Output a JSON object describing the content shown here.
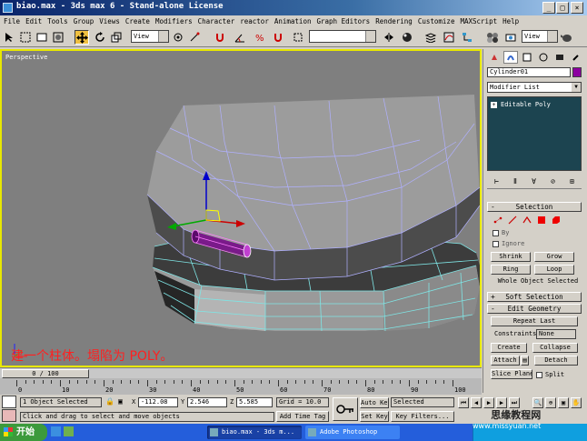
{
  "window": {
    "title": "biao.max - 3ds max 6 - Stand-alone License",
    "controls": [
      "minimize-icon",
      "maximize-icon",
      "close-icon"
    ]
  },
  "menu": [
    "File",
    "Edit",
    "Tools",
    "Group",
    "Views",
    "Create",
    "Modifiers",
    "Character",
    "reactor",
    "Animation",
    "Graph Editors",
    "Rendering",
    "Customize",
    "MAXScript",
    "Help"
  ],
  "toolbar": {
    "ref_coord": "View",
    "named_selection": "",
    "render_view": "View"
  },
  "viewport": {
    "label": "Perspective",
    "caption": "建一个柱体。塌陷为 POLY。"
  },
  "command_panel": {
    "object_name": "Cylinder01",
    "object_color": "#8c00a0",
    "modifier_list": "Modifier List",
    "stack_item": "Editable Poly",
    "selection": {
      "title": "Selection",
      "by": "By",
      "ignore": "Ignore",
      "shrink": "Shrink",
      "grow": "Grow",
      "ring": "Ring",
      "loop": "Loop",
      "status": "Whole Object Selected"
    },
    "soft_selection": "Soft Selection",
    "edit_geometry": {
      "title": "Edit Geometry",
      "repeat_last": "Repeat Last",
      "constraints_label": "Constraints:",
      "constraints_value": "None",
      "create": "Create",
      "collapse": "Collapse",
      "attach": "Attach",
      "detach": "Detach",
      "slice_plane": "Slice Plane",
      "split": "Split"
    }
  },
  "timeline": {
    "frame": "0 / 100",
    "ticks": [
      "0",
      "10",
      "20",
      "30",
      "40",
      "50",
      "60",
      "70",
      "80",
      "90",
      "100"
    ]
  },
  "status": {
    "selection": "1 Object Selected",
    "prompt": "Click and drag to select and move objects",
    "x": "-112.08",
    "y": "2.546",
    "z": "5.585",
    "grid": "Grid = 10.0",
    "add_time_tag": "Add Time Tag",
    "auto_key": "Auto Key",
    "key_mode": "Selected",
    "set_key": "Set Key",
    "key_filters": "Key Filters..."
  },
  "taskbar": {
    "start": "开始",
    "tasks": [
      "biao.max - 3ds m...",
      "Adobe Photoshop"
    ]
  },
  "watermark": {
    "line1": "思缘教程网",
    "line2": "www.missyuan.net"
  }
}
